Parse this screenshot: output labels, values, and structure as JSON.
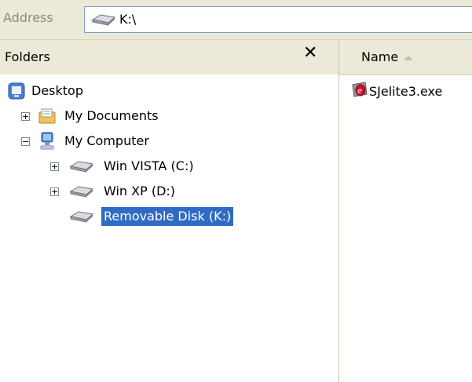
{
  "address": {
    "label": "Address",
    "value": "K:\\"
  },
  "folders_pane": {
    "title": "Folders",
    "close_symbol": "✕",
    "tree": {
      "desktop": "Desktop",
      "my_documents": "My Documents",
      "my_computer": "My Computer",
      "drive_c": "Win VISTA (C:)",
      "drive_d": "Win XP (D:)",
      "drive_k": "Removable Disk (K:)"
    },
    "expander_plus": "+",
    "expander_minus": "−"
  },
  "file_list": {
    "column_name": "Name",
    "files": [
      {
        "name": "SJelite3.exe",
        "icon": "app-exe-icon"
      }
    ]
  },
  "colors": {
    "selection": "#316ac5",
    "chrome": "#ece9d8"
  }
}
